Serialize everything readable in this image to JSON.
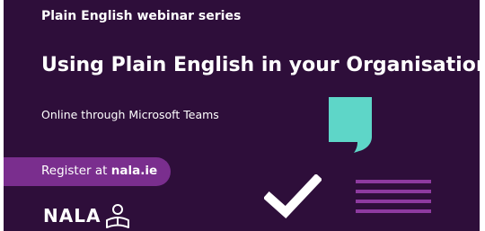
{
  "banner": {
    "series_label": "Plain English webinar series",
    "title": "Using Plain English in your Organisation",
    "subtitle": "Online through Microsoft Teams",
    "register_prefix": "Register at ",
    "register_site": "nala.ie",
    "logo_text": "NALA",
    "icons": [
      "speech-bubble-icon",
      "checkmark-icon",
      "text-lines-icon",
      "person-reading-icon"
    ],
    "colors": {
      "background": "#2e0e3a",
      "register_bar": "#7a2e8e",
      "accent_teal": "#5ed6c8",
      "accent_purple": "#8e3aa0"
    }
  }
}
